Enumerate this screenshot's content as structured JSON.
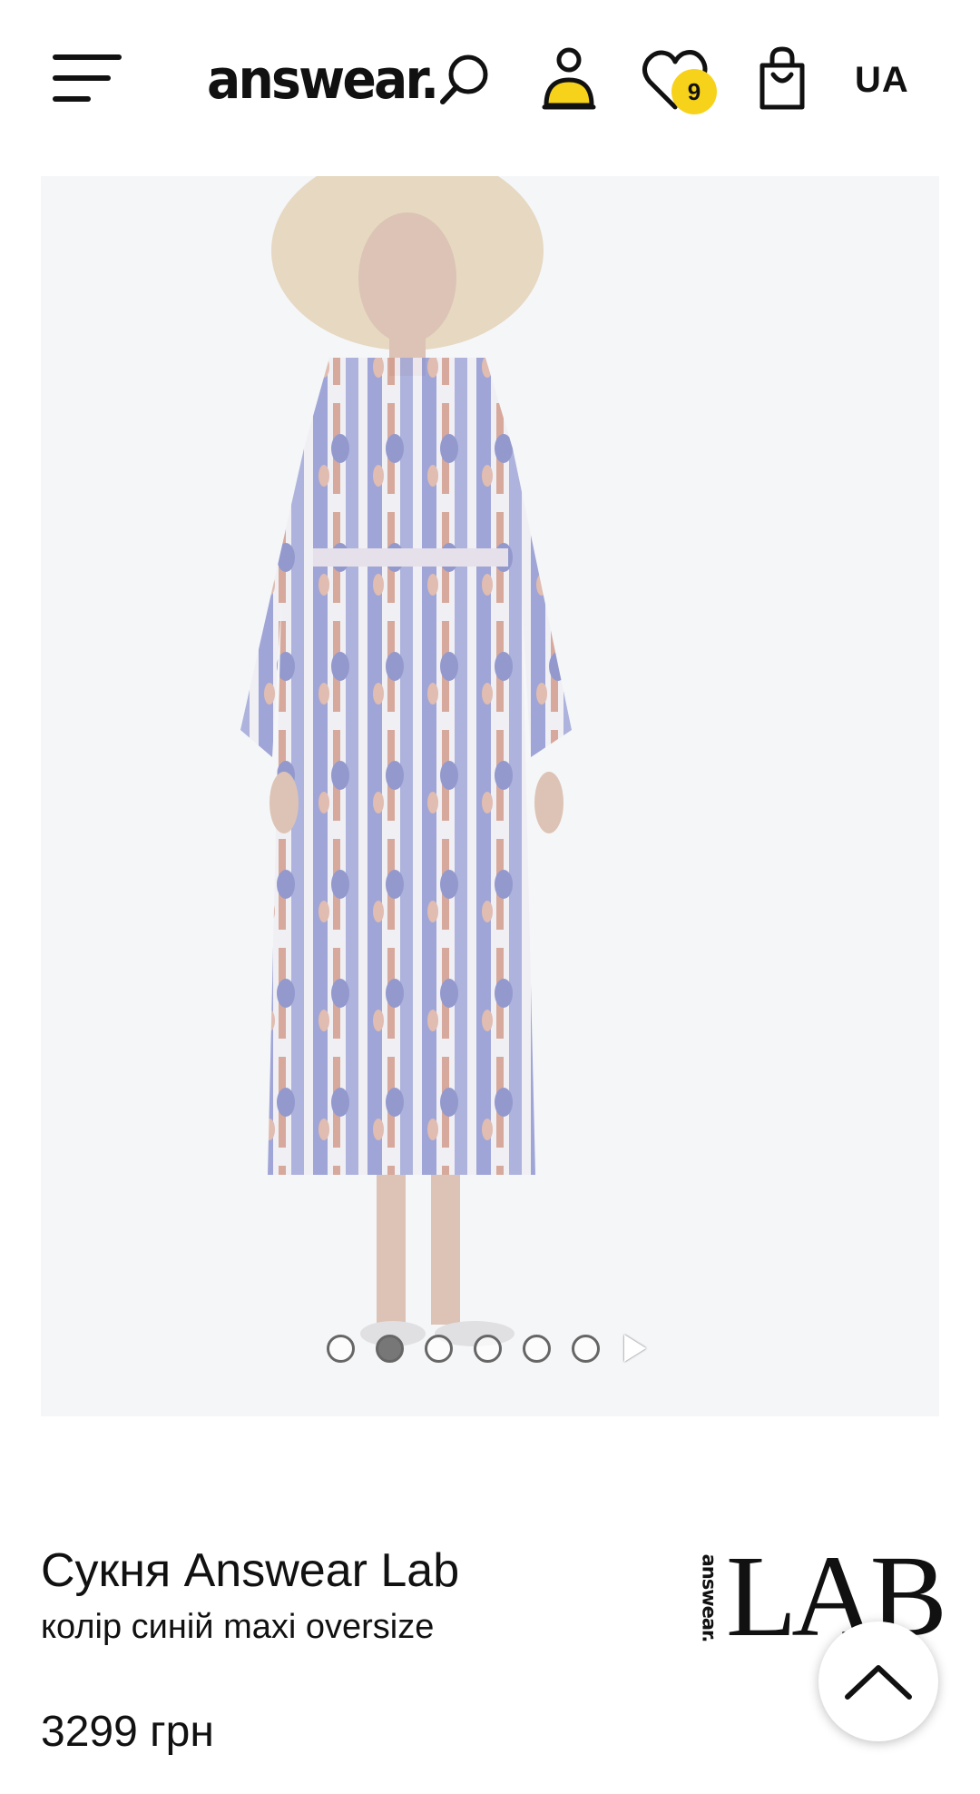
{
  "header": {
    "logo": "answear.",
    "language": "UA",
    "wishlist_count": "9",
    "icons": [
      "menu-icon",
      "search-icon",
      "user-icon",
      "heart-icon",
      "bag-icon"
    ]
  },
  "gallery": {
    "slide_count": 6,
    "active_index": 1
  },
  "product": {
    "title": "Сукня Answear Lab",
    "subtitle": "колір синій maxi oversize",
    "price": "3299 грн"
  },
  "brand": {
    "small": "answear.",
    "big": "LAB"
  },
  "colors": {
    "accent": "#f7d21b",
    "text": "#111111",
    "image_bg": "#f0f1f4",
    "dress_blue": "#4a55b5",
    "dress_rust": "#b8664e"
  }
}
